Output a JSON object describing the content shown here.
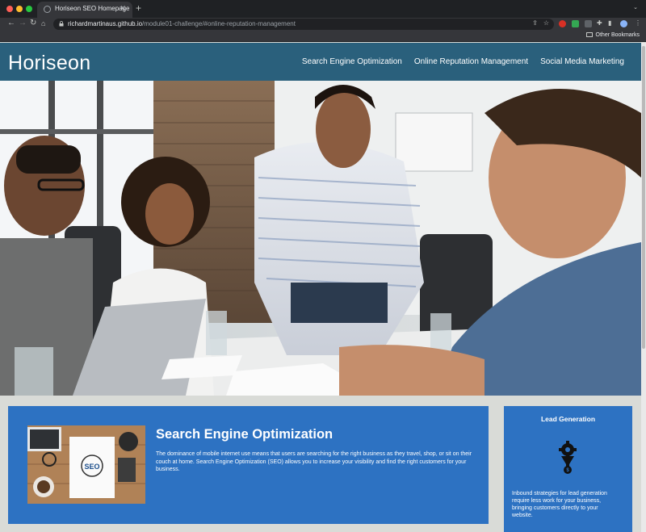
{
  "browser": {
    "tab_title": "Horiseon SEO Homepage",
    "url_host": "richardmartinaus.github.io",
    "url_path": "/module01-challenge/#online-reputation-management",
    "bookmarks_label": "Other Bookmarks",
    "icons": [
      "back-icon",
      "forward-icon",
      "reload-icon",
      "home-icon",
      "lock-icon",
      "share-icon",
      "star-icon",
      "extensions-icon",
      "menu-icon"
    ]
  },
  "site": {
    "logo": "Horiseon",
    "nav": [
      "Search Engine Optimization",
      "Online Reputation Management",
      "Social Media Marketing"
    ],
    "colors": {
      "header": "#2a607c",
      "card": "#2d72c2",
      "page_bg": "#d9dbd7"
    }
  },
  "seo": {
    "title": "Search Engine Optimization",
    "text": "The dominance of mobile internet use means that users are searching for the right business as they travel, shop, or sit on their couch at home. Search Engine Optimization (SEO) allows you to increase your visibility and find the right customers for your business."
  },
  "lead": {
    "title": "Lead Generation",
    "text": "Inbound strategies for lead generation require less work for your business, bringing customers directly to your website."
  }
}
